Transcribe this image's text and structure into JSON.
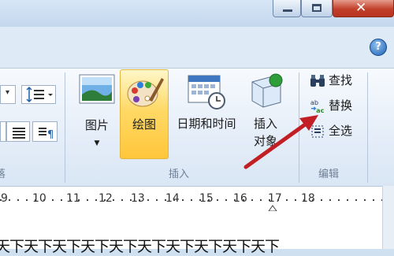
{
  "window_controls": {
    "minimize": "minimize-button",
    "maximize": "maximize-button",
    "close": "close-button"
  },
  "help": {
    "label": "?"
  },
  "insert_group": {
    "label": "插入",
    "picture": "图片",
    "drawing": "绘图",
    "datetime": "日期和时间",
    "object_line1": "插入",
    "object_line2": "对象"
  },
  "edit_group": {
    "label": "编辑",
    "find": "查找",
    "replace": "替换",
    "select_all": "全选"
  },
  "left_group": {
    "label": "落"
  },
  "ruler": {
    "labels": [
      "9",
      "10",
      "11",
      "12",
      "13",
      "14",
      "15",
      "16",
      "17",
      "18"
    ]
  },
  "document": {
    "text": "天下天下天下天下天下天下天下天下天下天下"
  },
  "colors": {
    "accent": "#ffd966",
    "arrow": "#c21f25"
  }
}
